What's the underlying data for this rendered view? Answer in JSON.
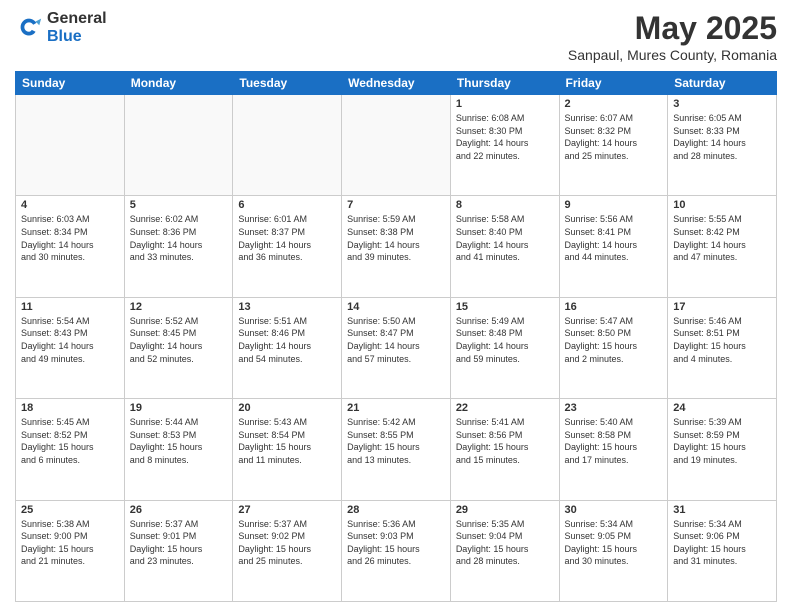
{
  "logo": {
    "general": "General",
    "blue": "Blue"
  },
  "title": "May 2025",
  "subtitle": "Sanpaul, Mures County, Romania",
  "days_header": [
    "Sunday",
    "Monday",
    "Tuesday",
    "Wednesday",
    "Thursday",
    "Friday",
    "Saturday"
  ],
  "weeks": [
    [
      {
        "day": "",
        "info": ""
      },
      {
        "day": "",
        "info": ""
      },
      {
        "day": "",
        "info": ""
      },
      {
        "day": "",
        "info": ""
      },
      {
        "day": "1",
        "info": "Sunrise: 6:08 AM\nSunset: 8:30 PM\nDaylight: 14 hours\nand 22 minutes."
      },
      {
        "day": "2",
        "info": "Sunrise: 6:07 AM\nSunset: 8:32 PM\nDaylight: 14 hours\nand 25 minutes."
      },
      {
        "day": "3",
        "info": "Sunrise: 6:05 AM\nSunset: 8:33 PM\nDaylight: 14 hours\nand 28 minutes."
      }
    ],
    [
      {
        "day": "4",
        "info": "Sunrise: 6:03 AM\nSunset: 8:34 PM\nDaylight: 14 hours\nand 30 minutes."
      },
      {
        "day": "5",
        "info": "Sunrise: 6:02 AM\nSunset: 8:36 PM\nDaylight: 14 hours\nand 33 minutes."
      },
      {
        "day": "6",
        "info": "Sunrise: 6:01 AM\nSunset: 8:37 PM\nDaylight: 14 hours\nand 36 minutes."
      },
      {
        "day": "7",
        "info": "Sunrise: 5:59 AM\nSunset: 8:38 PM\nDaylight: 14 hours\nand 39 minutes."
      },
      {
        "day": "8",
        "info": "Sunrise: 5:58 AM\nSunset: 8:40 PM\nDaylight: 14 hours\nand 41 minutes."
      },
      {
        "day": "9",
        "info": "Sunrise: 5:56 AM\nSunset: 8:41 PM\nDaylight: 14 hours\nand 44 minutes."
      },
      {
        "day": "10",
        "info": "Sunrise: 5:55 AM\nSunset: 8:42 PM\nDaylight: 14 hours\nand 47 minutes."
      }
    ],
    [
      {
        "day": "11",
        "info": "Sunrise: 5:54 AM\nSunset: 8:43 PM\nDaylight: 14 hours\nand 49 minutes."
      },
      {
        "day": "12",
        "info": "Sunrise: 5:52 AM\nSunset: 8:45 PM\nDaylight: 14 hours\nand 52 minutes."
      },
      {
        "day": "13",
        "info": "Sunrise: 5:51 AM\nSunset: 8:46 PM\nDaylight: 14 hours\nand 54 minutes."
      },
      {
        "day": "14",
        "info": "Sunrise: 5:50 AM\nSunset: 8:47 PM\nDaylight: 14 hours\nand 57 minutes."
      },
      {
        "day": "15",
        "info": "Sunrise: 5:49 AM\nSunset: 8:48 PM\nDaylight: 14 hours\nand 59 minutes."
      },
      {
        "day": "16",
        "info": "Sunrise: 5:47 AM\nSunset: 8:50 PM\nDaylight: 15 hours\nand 2 minutes."
      },
      {
        "day": "17",
        "info": "Sunrise: 5:46 AM\nSunset: 8:51 PM\nDaylight: 15 hours\nand 4 minutes."
      }
    ],
    [
      {
        "day": "18",
        "info": "Sunrise: 5:45 AM\nSunset: 8:52 PM\nDaylight: 15 hours\nand 6 minutes."
      },
      {
        "day": "19",
        "info": "Sunrise: 5:44 AM\nSunset: 8:53 PM\nDaylight: 15 hours\nand 8 minutes."
      },
      {
        "day": "20",
        "info": "Sunrise: 5:43 AM\nSunset: 8:54 PM\nDaylight: 15 hours\nand 11 minutes."
      },
      {
        "day": "21",
        "info": "Sunrise: 5:42 AM\nSunset: 8:55 PM\nDaylight: 15 hours\nand 13 minutes."
      },
      {
        "day": "22",
        "info": "Sunrise: 5:41 AM\nSunset: 8:56 PM\nDaylight: 15 hours\nand 15 minutes."
      },
      {
        "day": "23",
        "info": "Sunrise: 5:40 AM\nSunset: 8:58 PM\nDaylight: 15 hours\nand 17 minutes."
      },
      {
        "day": "24",
        "info": "Sunrise: 5:39 AM\nSunset: 8:59 PM\nDaylight: 15 hours\nand 19 minutes."
      }
    ],
    [
      {
        "day": "25",
        "info": "Sunrise: 5:38 AM\nSunset: 9:00 PM\nDaylight: 15 hours\nand 21 minutes."
      },
      {
        "day": "26",
        "info": "Sunrise: 5:37 AM\nSunset: 9:01 PM\nDaylight: 15 hours\nand 23 minutes."
      },
      {
        "day": "27",
        "info": "Sunrise: 5:37 AM\nSunset: 9:02 PM\nDaylight: 15 hours\nand 25 minutes."
      },
      {
        "day": "28",
        "info": "Sunrise: 5:36 AM\nSunset: 9:03 PM\nDaylight: 15 hours\nand 26 minutes."
      },
      {
        "day": "29",
        "info": "Sunrise: 5:35 AM\nSunset: 9:04 PM\nDaylight: 15 hours\nand 28 minutes."
      },
      {
        "day": "30",
        "info": "Sunrise: 5:34 AM\nSunset: 9:05 PM\nDaylight: 15 hours\nand 30 minutes."
      },
      {
        "day": "31",
        "info": "Sunrise: 5:34 AM\nSunset: 9:06 PM\nDaylight: 15 hours\nand 31 minutes."
      }
    ]
  ]
}
